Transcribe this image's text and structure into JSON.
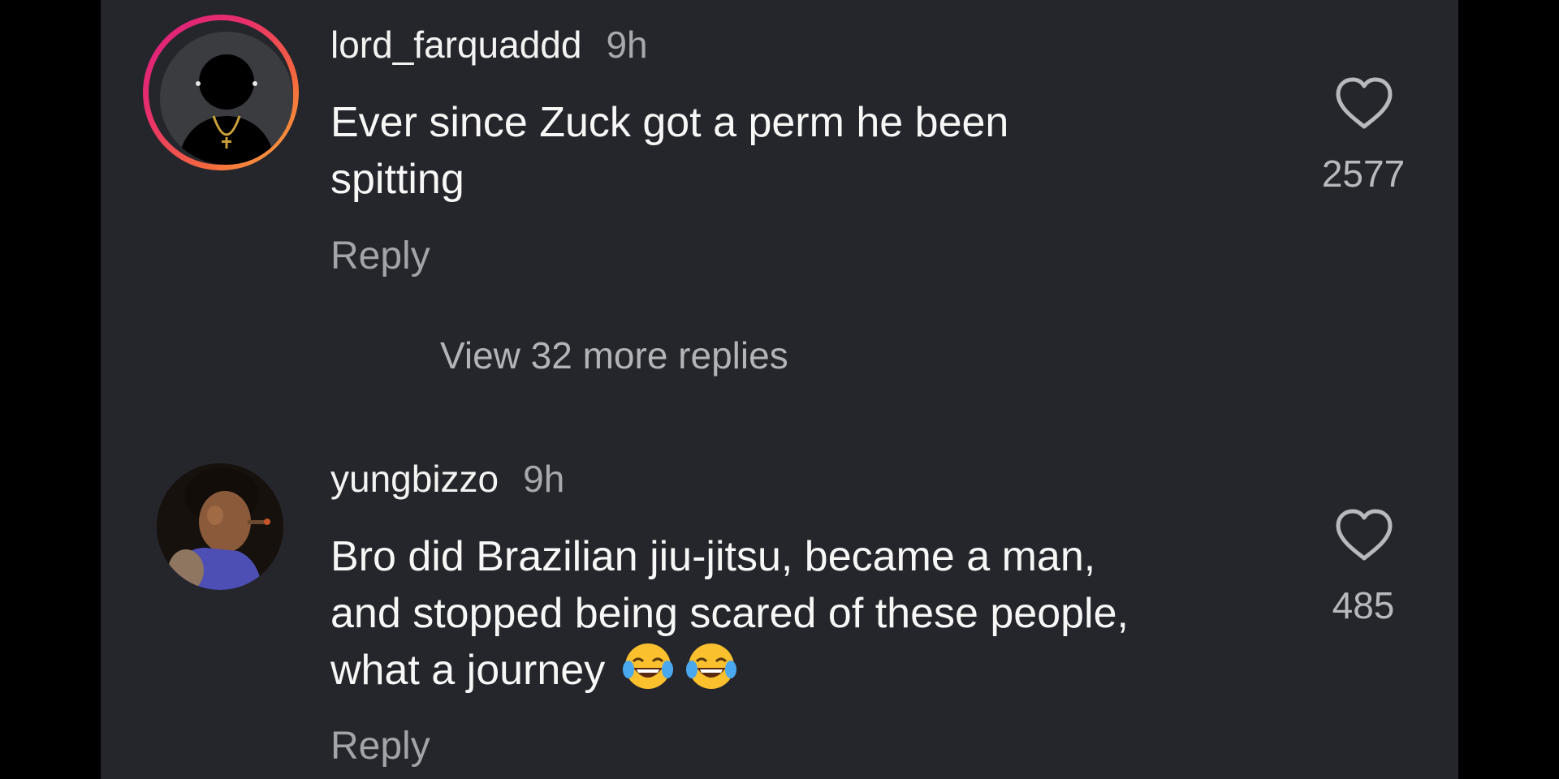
{
  "comments": [
    {
      "username": "lord_farquaddd",
      "time": "9h",
      "text_line1": "Ever since Zuck got a perm he been",
      "text_line2": "spitting",
      "reply_label": "Reply",
      "likes": "2577",
      "avatar": "silhouette-with-cross-necklace",
      "has_story_ring": true
    },
    {
      "username": "yungbizzo",
      "time": "9h",
      "text_line1": "Bro did Brazilian jiu-jitsu, became a man,",
      "text_line2": "and stopped being scared of these people,",
      "text_line3": "what a journey",
      "emojis": "😂😂",
      "reply_label": "Reply",
      "likes": "485",
      "avatar": "man-smoking-cigar-photo",
      "has_story_ring": false
    }
  ],
  "view_more_replies": "View 32 more replies",
  "icons": {
    "like": "heart-outline-icon",
    "emoji": "face-with-tears-of-joy"
  },
  "colors": {
    "background": "#25262b",
    "story_ring_start": "#d91d7e",
    "story_ring_end": "#fbb03b",
    "text_primary": "#f7f7f7",
    "text_secondary": "#a3a4a8"
  }
}
